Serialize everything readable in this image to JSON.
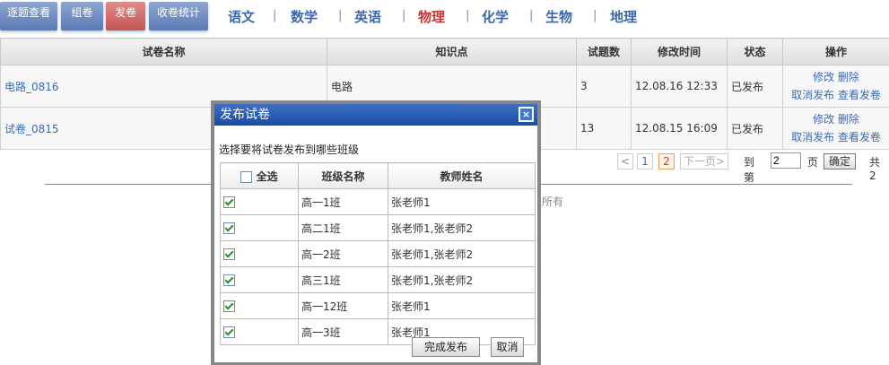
{
  "nav": {
    "buttons": [
      "逐题查看",
      "组卷",
      "发卷",
      "收卷统计"
    ],
    "subjects": [
      "语文",
      "数学",
      "英语",
      "物理",
      "化学",
      "生物",
      "地理"
    ],
    "separator": "|",
    "active_button": "发卷",
    "active_subject": "物理"
  },
  "table": {
    "headers": [
      "试卷名称",
      "知识点",
      "试题数",
      "修改时间",
      "状态",
      "操作"
    ],
    "rows": [
      {
        "name": "电路_0816",
        "topic": "电路",
        "count": "3",
        "time": "12.08.16 12:33",
        "status": "已发布",
        "op_edit": "修改",
        "op_delete": "删除",
        "op_cancel": "取消发布",
        "op_view": "查看发卷"
      },
      {
        "name": "试卷_0815",
        "topic": "",
        "count": "13",
        "time": "12.08.15 16:09",
        "status": "已发布",
        "op_edit": "修改",
        "op_delete": "删除",
        "op_cancel": "取消发布",
        "op_view": "查看发卷"
      }
    ]
  },
  "pager": {
    "prev": "<",
    "page1": "1",
    "page2": "2",
    "next": "下一页>",
    "goto_label": "到第",
    "page_value": "2",
    "page_unit": "页",
    "confirm": "确定",
    "total": "共2"
  },
  "footer_fragment": "所有",
  "dialog": {
    "title": "发布试卷",
    "close": "×",
    "message": "选择要将试卷发布到哪些班级",
    "col_select_all": "全选",
    "col_class": "班级名称",
    "col_teacher": "教师姓名",
    "classes": [
      {
        "name": "高一1班",
        "teacher": "张老师1",
        "checked": true
      },
      {
        "name": "高二1班",
        "teacher": "张老师1,张老师2",
        "checked": true
      },
      {
        "name": "高一2班",
        "teacher": "张老师1,张老师2",
        "checked": true
      },
      {
        "name": "高三1班",
        "teacher": "张老师1,张老师2",
        "checked": true
      },
      {
        "name": "高一12班",
        "teacher": "张老师1",
        "checked": true
      },
      {
        "name": "高一3班",
        "teacher": "张老师1",
        "checked": true
      }
    ],
    "publish_button": "完成发布",
    "cancel_button": "取消"
  }
}
